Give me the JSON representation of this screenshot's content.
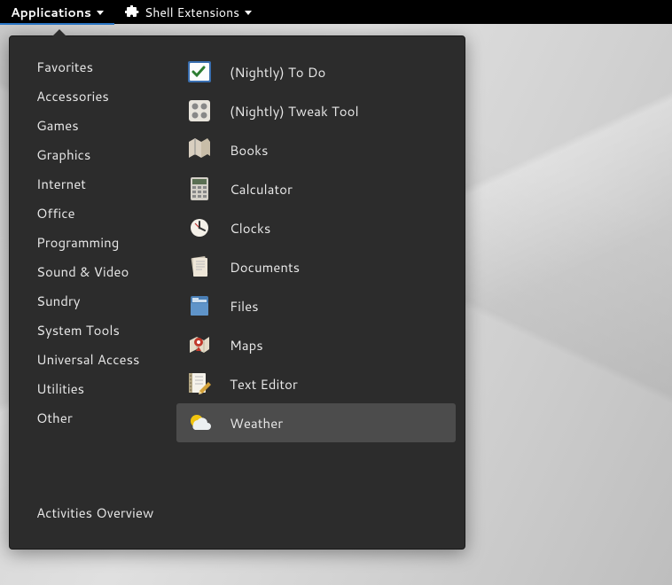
{
  "topbar": {
    "applications": "Applications",
    "shell_extensions": "Shell Extensions"
  },
  "menu": {
    "categories": [
      "Favorites",
      "Accessories",
      "Games",
      "Graphics",
      "Internet",
      "Office",
      "Programming",
      "Sound & Video",
      "Sundry",
      "System Tools",
      "Universal Access",
      "Utilities",
      "Other"
    ],
    "activities": "Activities Overview",
    "apps": [
      {
        "label": "(Nightly) To Do",
        "icon": "todo-icon",
        "selected": false
      },
      {
        "label": "(Nightly) Tweak Tool",
        "icon": "tweak-icon",
        "selected": false
      },
      {
        "label": "Books",
        "icon": "books-icon",
        "selected": false
      },
      {
        "label": "Calculator",
        "icon": "calculator-icon",
        "selected": false
      },
      {
        "label": "Clocks",
        "icon": "clocks-icon",
        "selected": false
      },
      {
        "label": "Documents",
        "icon": "documents-icon",
        "selected": false
      },
      {
        "label": "Files",
        "icon": "files-icon",
        "selected": false
      },
      {
        "label": "Maps",
        "icon": "maps-icon",
        "selected": false
      },
      {
        "label": "Text Editor",
        "icon": "texteditor-icon",
        "selected": false
      },
      {
        "label": "Weather",
        "icon": "weather-icon",
        "selected": true
      }
    ]
  }
}
